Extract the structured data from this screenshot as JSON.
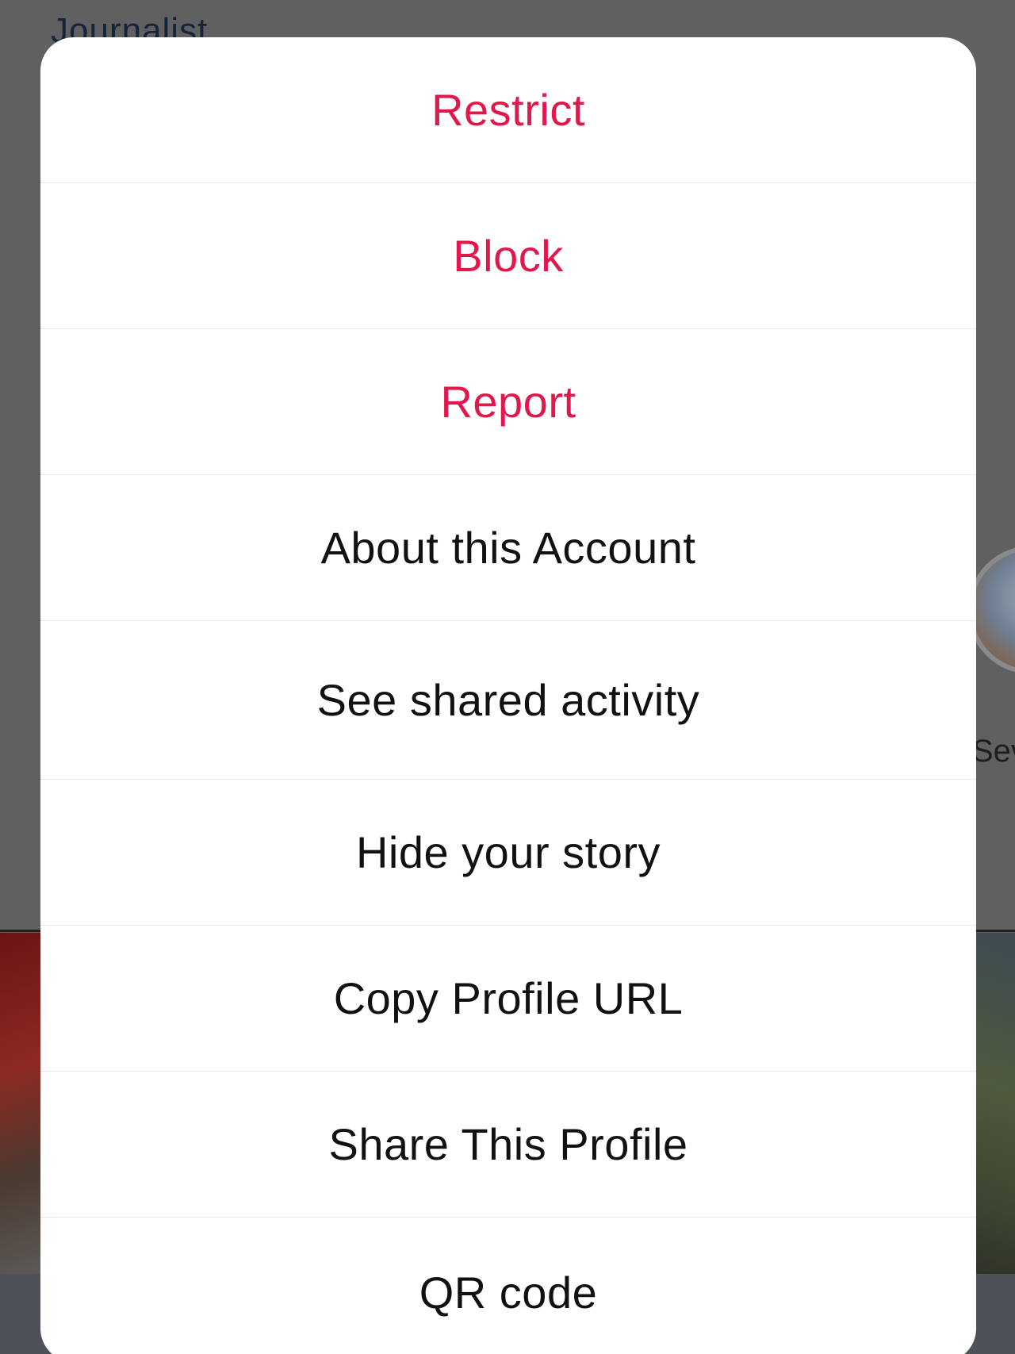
{
  "background": {
    "top_text": "Journalist",
    "story_label": "Sev"
  },
  "action_sheet": {
    "destructive_color": "#e0184c",
    "text_color": "#111111",
    "items": [
      {
        "label": "Restrict",
        "destructive": true
      },
      {
        "label": "Block",
        "destructive": true
      },
      {
        "label": "Report",
        "destructive": true
      },
      {
        "label": "About this Account",
        "destructive": false
      },
      {
        "label": "See shared activity",
        "destructive": false
      },
      {
        "label": "Hide your story",
        "destructive": false
      },
      {
        "label": "Copy Profile URL",
        "destructive": false
      },
      {
        "label": "Share This Profile",
        "destructive": false
      },
      {
        "label": "QR code",
        "destructive": false
      }
    ]
  }
}
